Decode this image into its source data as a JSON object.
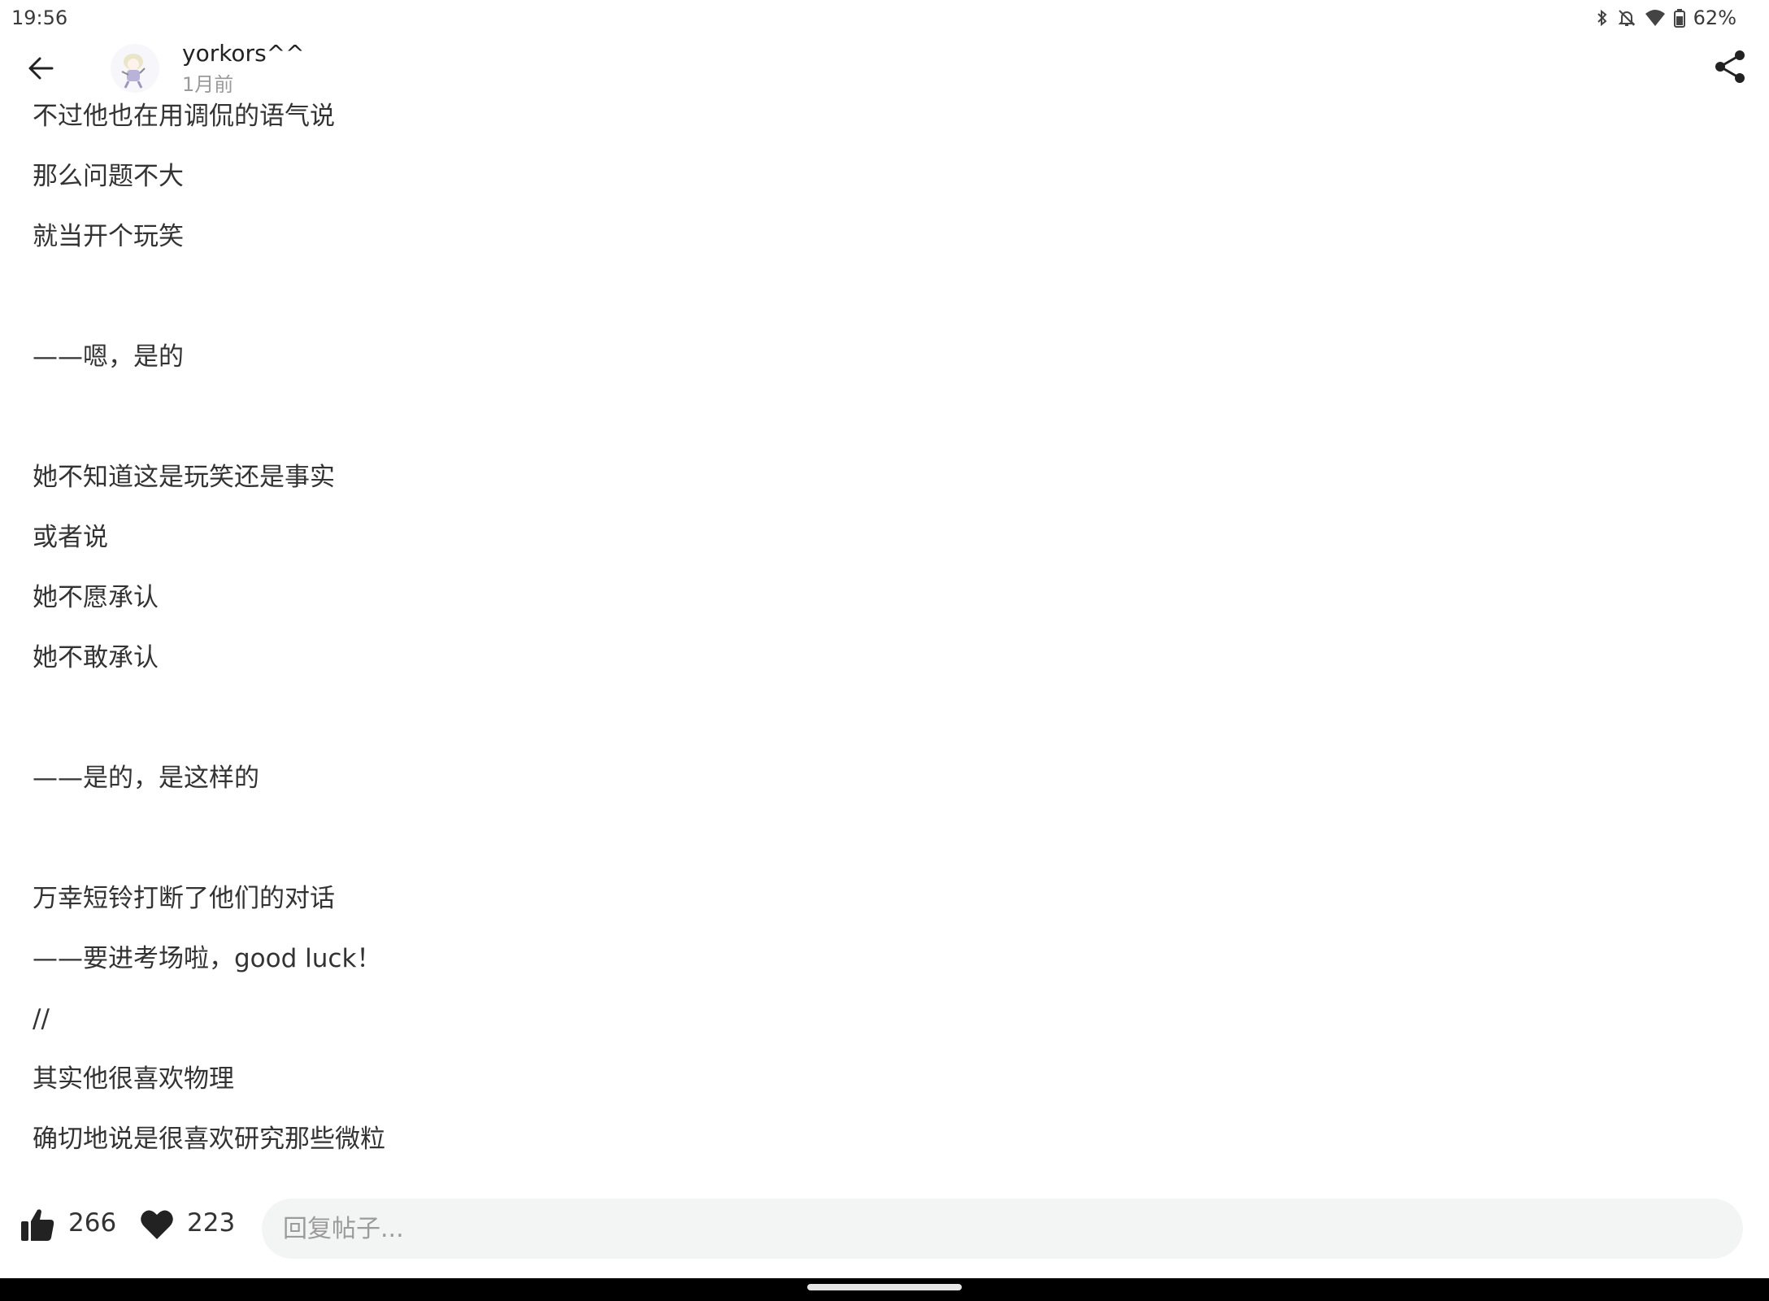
{
  "status_bar": {
    "time": "19:56",
    "battery": "62%",
    "icons": [
      "bluetooth-icon",
      "notifications-off-icon",
      "wifi-icon",
      "battery-icon"
    ]
  },
  "header": {
    "author": "yorkors^^",
    "time": "1月前",
    "icons": [
      "back-arrow-icon",
      "avatar",
      "share-icon"
    ]
  },
  "content": {
    "lines": [
      "不过他也在用调侃的语气说",
      "那么问题不大",
      "就当开个玩笑",
      "",
      "——嗯，是的",
      "",
      "她不知道这是玩笑还是事实",
      "或者说",
      "她不愿承认",
      "她不敢承认",
      "",
      "——是的，是这样的",
      "",
      "万幸短铃打断了他们的对话",
      "——要进考场啦，good luck！",
      "//",
      "其实他很喜欢物理",
      "确切地说是很喜欢研究那些微粒"
    ]
  },
  "action_bar": {
    "like_count": "266",
    "favorite_count": "223",
    "reply_placeholder": "回复帖子..."
  }
}
